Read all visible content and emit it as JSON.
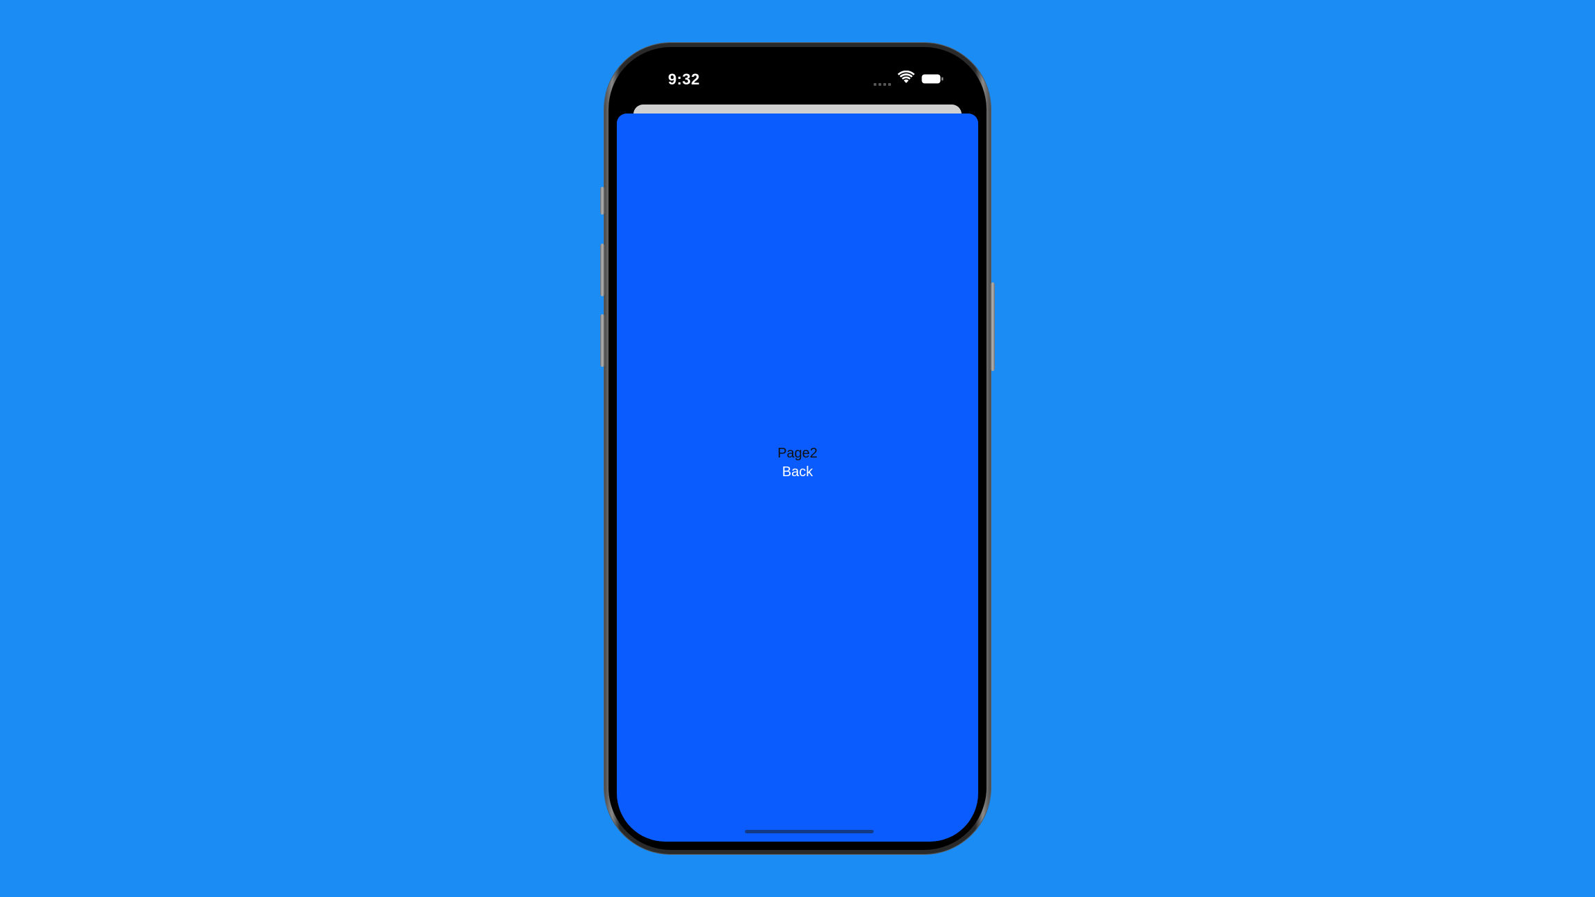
{
  "status_bar": {
    "time": "9:32",
    "icons": [
      "cellular-signal-icon",
      "wifi-icon",
      "battery-icon"
    ]
  },
  "screen": {
    "title": "Page2",
    "back_label": "Back",
    "background_color": "#0a5cff",
    "label_color": "#111111",
    "button_color": "#ffffff"
  },
  "backdrop_color": "#1a8cf3"
}
